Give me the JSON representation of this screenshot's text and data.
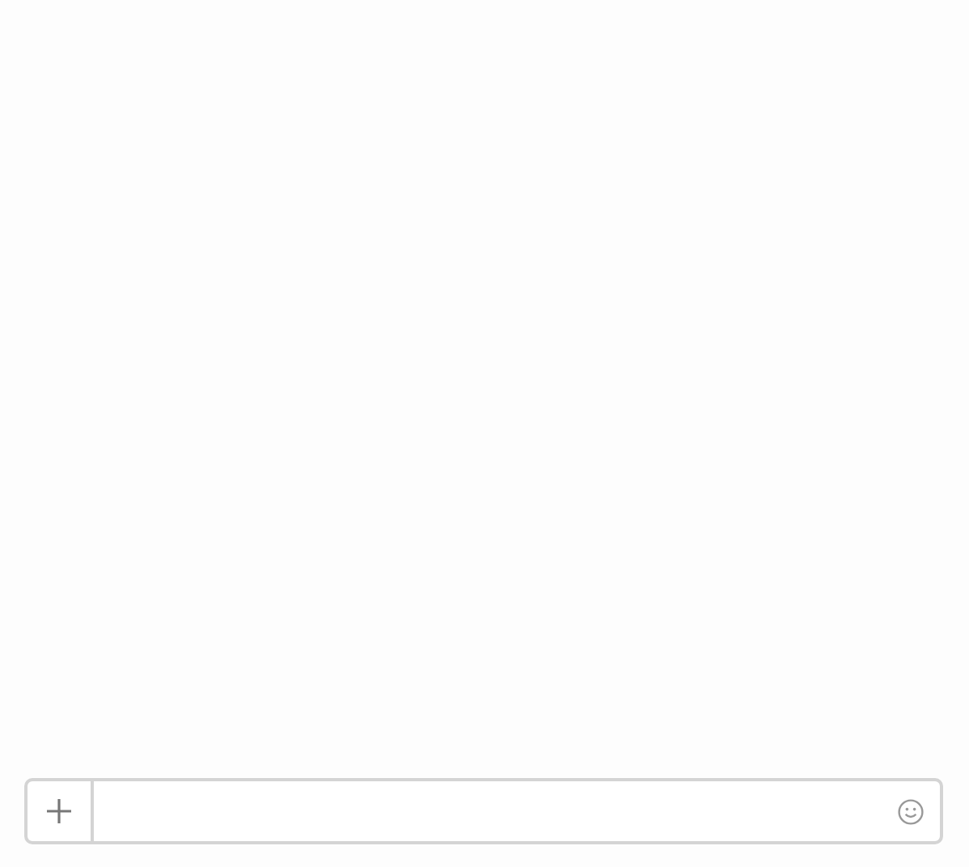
{
  "composer": {
    "attach_button": true,
    "emoji_button": true
  }
}
